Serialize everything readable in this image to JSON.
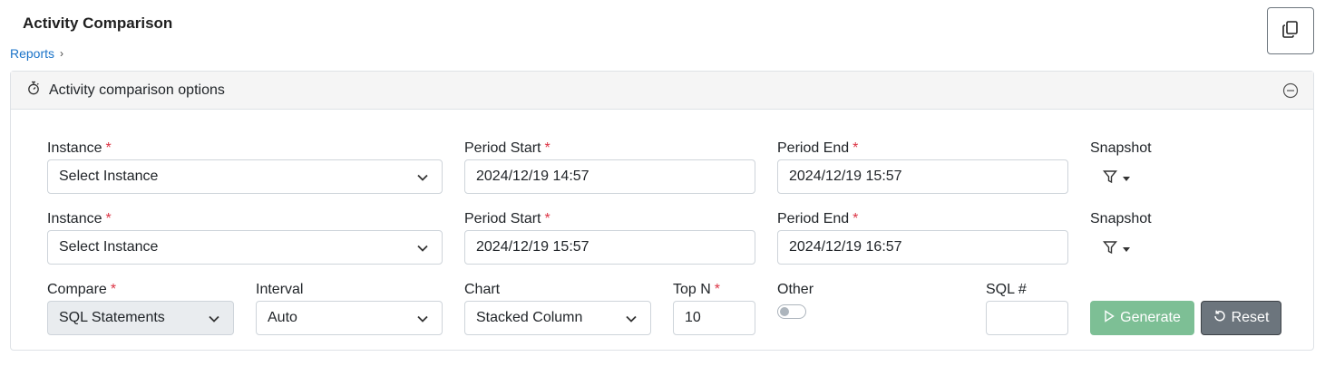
{
  "page": {
    "title": "Activity Comparison"
  },
  "breadcrumb": {
    "items": [
      "Reports"
    ],
    "separator": "›"
  },
  "panel": {
    "title": "Activity comparison options"
  },
  "row1": {
    "instance_label": "Instance",
    "instance_value": "Select Instance",
    "period_start_label": "Period Start",
    "period_start_value": "2024/12/19 14:57",
    "period_end_label": "Period End",
    "period_end_value": "2024/12/19 15:57",
    "snapshot_label": "Snapshot"
  },
  "row2": {
    "instance_label": "Instance",
    "instance_value": "Select Instance",
    "period_start_label": "Period Start",
    "period_start_value": "2024/12/19 15:57",
    "period_end_label": "Period End",
    "period_end_value": "2024/12/19 16:57",
    "snapshot_label": "Snapshot"
  },
  "row3": {
    "compare_label": "Compare",
    "compare_value": "SQL Statements",
    "interval_label": "Interval",
    "interval_value": "Auto",
    "chart_label": "Chart",
    "chart_value": "Stacked Column",
    "topn_label": "Top N",
    "topn_value": "10",
    "other_label": "Other",
    "other_enabled": false,
    "sql_label": "SQL #",
    "sql_value": ""
  },
  "required_mark": "*",
  "buttons": {
    "generate": "Generate",
    "reset": "Reset"
  },
  "icons": {
    "copy": "copy-icon",
    "stopwatch": "stopwatch-icon",
    "collapse": "minus-circle-icon",
    "chevron": "chevron-down-icon",
    "filter": "filter-icon",
    "play": "play-icon",
    "reset": "undo-icon"
  },
  "colors": {
    "link": "#1a73c8",
    "required": "#dc3545",
    "generate_bg": "#7dbf95",
    "reset_bg": "#6c757d"
  }
}
